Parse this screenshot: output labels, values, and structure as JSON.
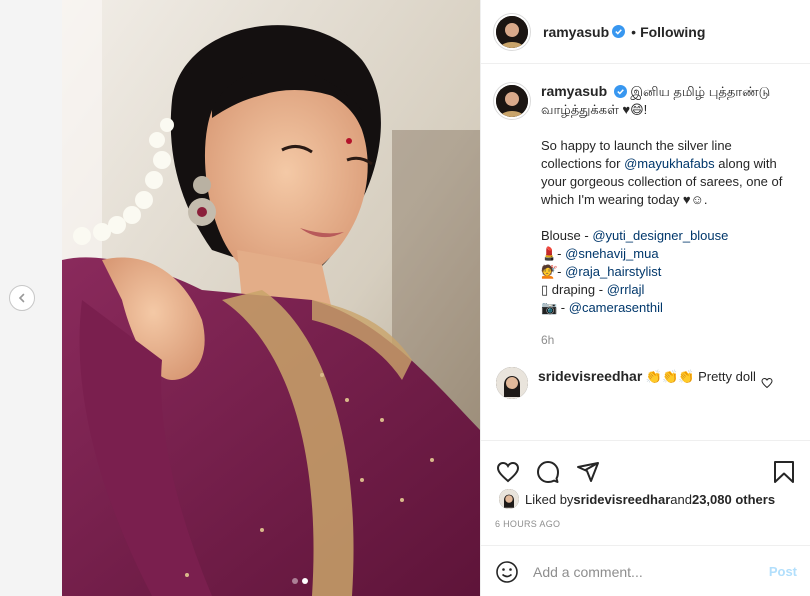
{
  "header": {
    "username": "ramyasub",
    "follow_status": "Following",
    "separator": "•"
  },
  "caption": {
    "username": "ramyasub",
    "tamil_text": "இனிய தமிழ் புத்தாண்டு வாழ்த்துக்கள் ♥😄!",
    "line1_pre": "So happy to launch the silver line collections for ",
    "line1_mention": "@mayukhafabs",
    "line1_post": " along with your gorgeous collection of sarees, one of which I'm wearing today ♥☺.",
    "credits": [
      {
        "prefix": "Blouse - ",
        "mention": "@yuti_designer_blouse"
      },
      {
        "prefix": "💄- ",
        "mention": "@snehavij_mua"
      },
      {
        "prefix": "💇- ",
        "mention": "@raja_hairstylist"
      },
      {
        "prefix": "▯ draping - ",
        "mention": "@rrlajl"
      },
      {
        "prefix": "📷 - ",
        "mention": "@camerasenthil"
      }
    ],
    "time": "6h"
  },
  "comment": {
    "username": "sridevisreedhar",
    "text": " 👏👏👏 Pretty doll"
  },
  "likes": {
    "prefix": "Liked by ",
    "user": "sridevisreedhar",
    "middle": " and ",
    "count": "23,080 others"
  },
  "timestamp": "6 HOURS AGO",
  "comment_box": {
    "placeholder": "Add a comment...",
    "post_label": "Post"
  },
  "icons": {
    "verified": "verified-badge-icon",
    "like": "heart-icon",
    "comment": "comment-icon",
    "share": "share-icon",
    "save": "bookmark-icon",
    "emoji": "emoji-icon",
    "prev": "chevron-left-icon"
  },
  "colors": {
    "verified": "#3897f0",
    "mention": "#00376b",
    "post_disabled": "#b2dffc",
    "saree": "#7a1f4e"
  },
  "carousel": {
    "count": 2,
    "active": 1
  }
}
